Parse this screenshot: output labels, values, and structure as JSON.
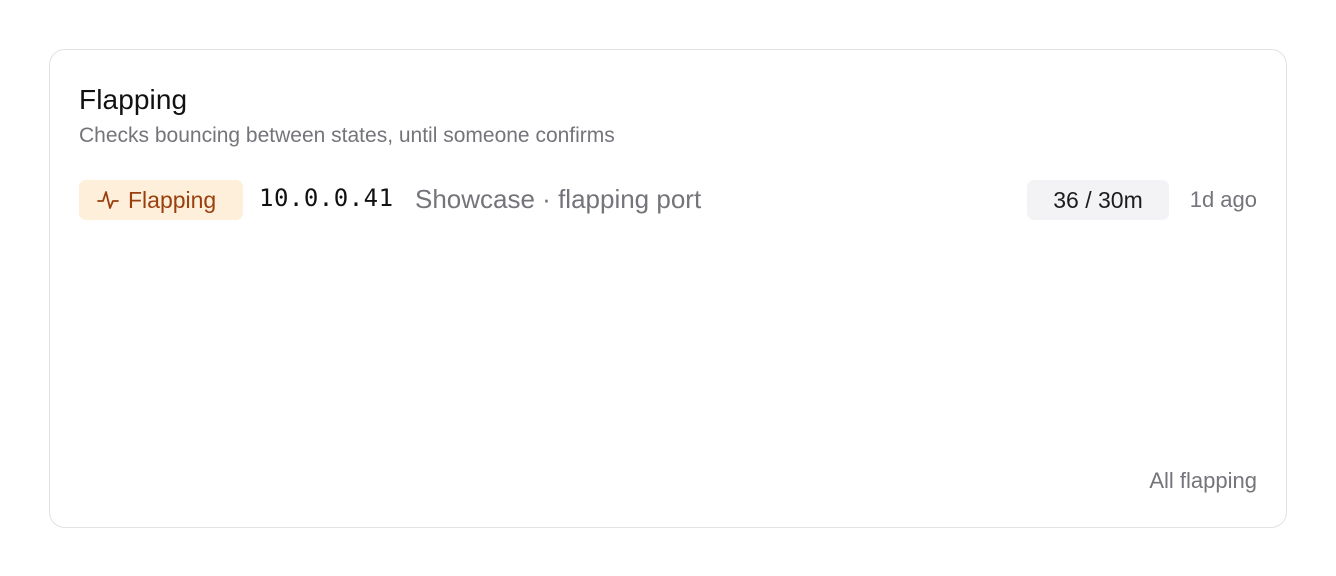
{
  "card": {
    "title": "Flapping",
    "subtitle": "Checks bouncing between states, until someone confirms",
    "footer_link": "All flapping"
  },
  "rows": [
    {
      "badge": {
        "icon": "pulse-icon",
        "label": "Flapping",
        "bg_color": "#fdefd9",
        "text_color": "#9a3f0d"
      },
      "ip": "10.0.0.41",
      "description": "Showcase · flapping port",
      "count": "36 / 30m",
      "age": "1d ago"
    }
  ]
}
